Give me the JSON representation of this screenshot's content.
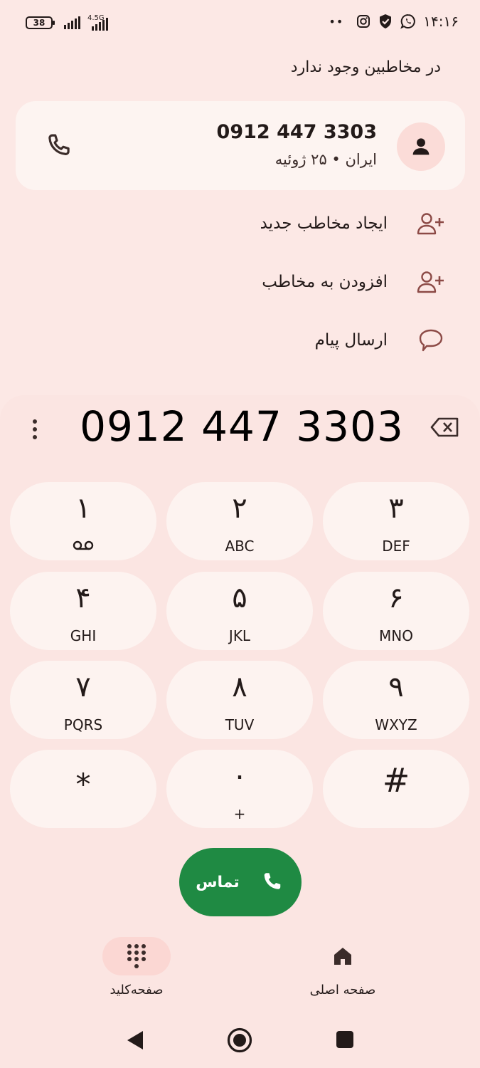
{
  "status_bar": {
    "battery": "38",
    "network": "4.5G",
    "time": "۱۴:۱۶",
    "dots": "••",
    "icons": [
      "instagram-icon",
      "shield-check-icon",
      "whatsapp-icon"
    ]
  },
  "top": {
    "no_contact_text": "در مخاطبین وجود ندارد",
    "card": {
      "number": "0912 447 3303",
      "meta": "ایران • ۲۵ ژوئیه"
    },
    "actions": [
      {
        "label": "ایجاد مخاطب جدید",
        "icon": "person-add-icon"
      },
      {
        "label": "افزودن به مخاطب",
        "icon": "person-add-icon"
      },
      {
        "label": "ارسال پیام",
        "icon": "message-icon"
      }
    ]
  },
  "dialer": {
    "dialed_number": "0912 447 3303",
    "keys": [
      {
        "digit": "۱",
        "letters": ""
      },
      {
        "digit": "۲",
        "letters": "ABC"
      },
      {
        "digit": "۳",
        "letters": "DEF"
      },
      {
        "digit": "۴",
        "letters": "GHI"
      },
      {
        "digit": "۵",
        "letters": "JKL"
      },
      {
        "digit": "۶",
        "letters": "MNO"
      },
      {
        "digit": "۷",
        "letters": "PQRS"
      },
      {
        "digit": "۸",
        "letters": "TUV"
      },
      {
        "digit": "۹",
        "letters": "WXYZ"
      },
      {
        "digit": "*",
        "letters": ""
      },
      {
        "digit": "۰",
        "letters": "+"
      },
      {
        "digit": "#",
        "letters": ""
      }
    ],
    "call_label": "تماس"
  },
  "bottom_nav": {
    "keypad_label": "صفحه‌کلید",
    "home_label": "صفحه اصلی"
  },
  "colors": {
    "background": "#fce8e5",
    "card": "#fdf4f1",
    "accent": "#8c4a46",
    "call_green": "#1f8a43"
  }
}
